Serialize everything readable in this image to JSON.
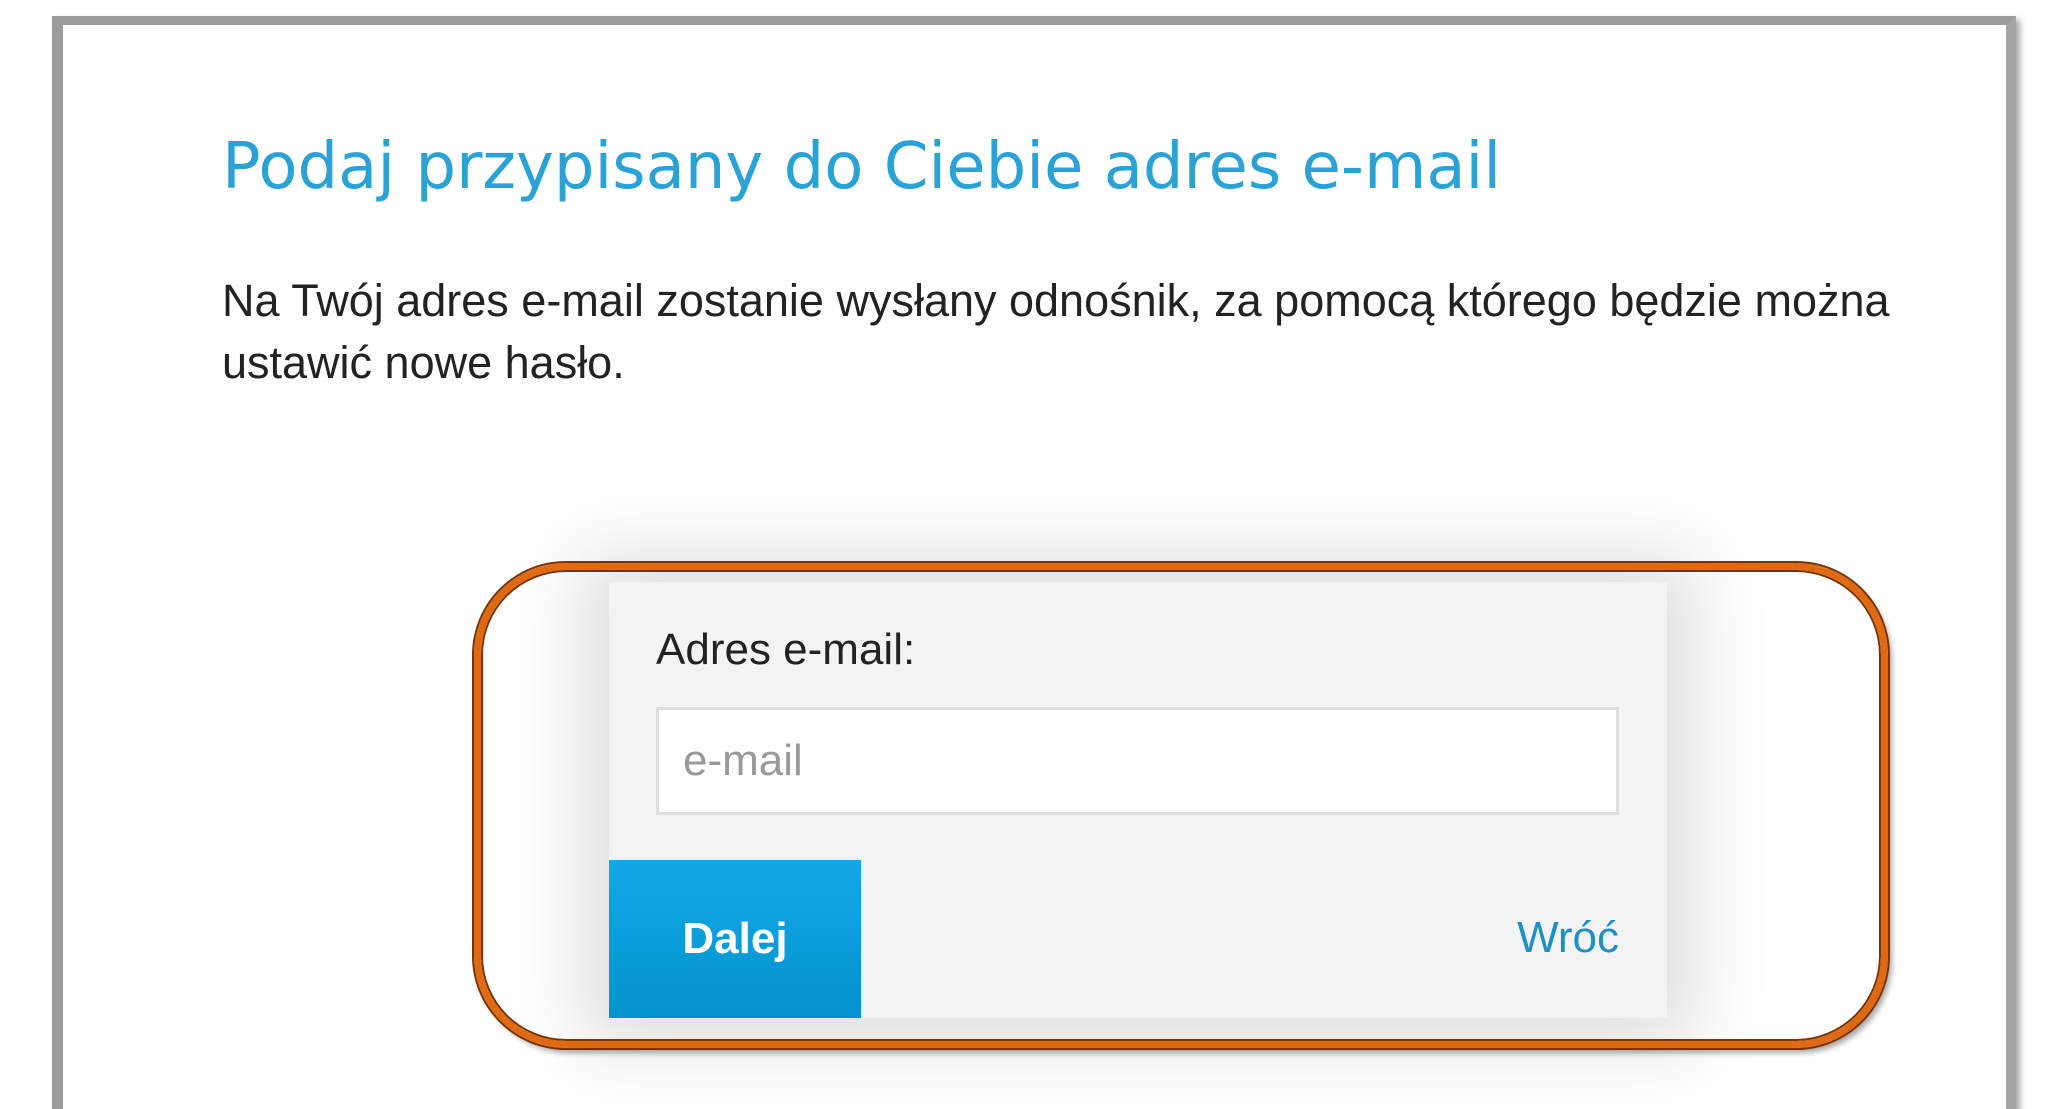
{
  "page": {
    "title": "Podaj przypisany do Ciebie adres e-mail",
    "description": "Na Twój adres e-mail zostanie wysłany odnośnik, za pomocą którego będzie można ustawić nowe hasło."
  },
  "form": {
    "email_label": "Adres e-mail:",
    "email_placeholder": "e-mail",
    "email_value": "",
    "next_label": "Dalej",
    "back_label": "Wróć"
  },
  "colors": {
    "title": "#2aa2d6",
    "primary_button": "#0a9ddb",
    "link": "#1e90c8",
    "highlight": "#e06a13",
    "frame": "#9b9b9b"
  }
}
